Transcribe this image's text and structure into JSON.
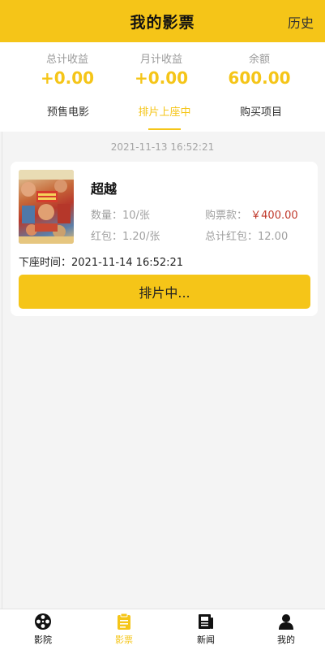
{
  "header": {
    "title": "我的影票",
    "history_label": "历史"
  },
  "stats": [
    {
      "label": "总计收益",
      "value": "+0.00"
    },
    {
      "label": "月计收益",
      "value": "+0.00"
    },
    {
      "label": "余额",
      "value": "600.00"
    }
  ],
  "tabs": [
    {
      "label": "预售电影",
      "active": false
    },
    {
      "label": "排片上座中",
      "active": true
    },
    {
      "label": "购买项目",
      "active": false
    }
  ],
  "order": {
    "date": "2021-11-13 16:52:21",
    "movie_name": "超越",
    "quantity_label": "数量：10/张",
    "price_label": "购票款：",
    "price_value": "￥400.00",
    "red_packet_label": "红包：1.20/张",
    "total_red_packet_label": "总计红包：12.00",
    "release_time_label": "下座时间：2021-11-14 16:52:21",
    "action_label": "排片中..."
  },
  "tabbar": [
    {
      "label": "影院",
      "icon": "film-reel-icon",
      "active": false
    },
    {
      "label": "影票",
      "icon": "clipboard-icon",
      "active": true
    },
    {
      "label": "新闻",
      "icon": "newspaper-icon",
      "active": false
    },
    {
      "label": "我的",
      "icon": "person-icon",
      "active": false
    }
  ],
  "colors": {
    "accent": "#f5c518",
    "price": "#c0392b",
    "muted": "#a0a0a0",
    "background": "#f4f4f4"
  }
}
